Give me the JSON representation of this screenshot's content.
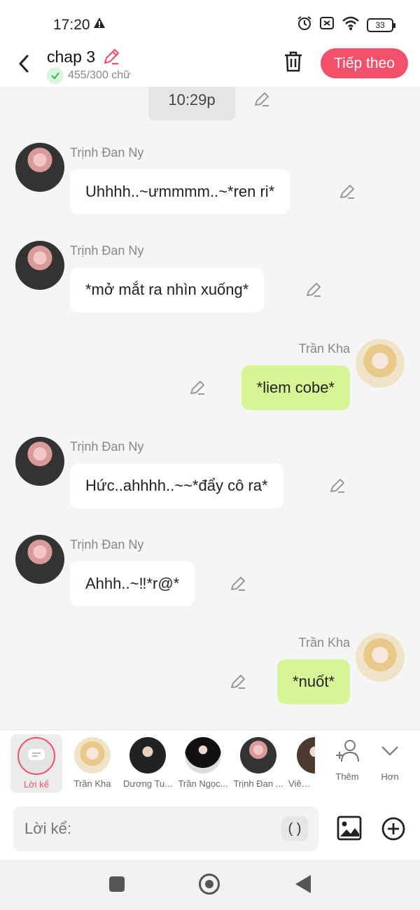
{
  "status": {
    "time": "17:20",
    "battery": "33"
  },
  "header": {
    "title": "chap 3",
    "word_count": "455/300 chữ",
    "next_label": "Tiếp theo"
  },
  "chat": {
    "time_label": "10:29p",
    "messages": [
      {
        "side": "left",
        "speaker": "Trịnh Đan Ny",
        "text": "Uhhhh..~ưmmmm..~*ren ri*"
      },
      {
        "side": "left",
        "speaker": "Trịnh Đan Ny",
        "text": "*mở mắt ra nhìn xuống*"
      },
      {
        "side": "right",
        "speaker": "Trần Kha",
        "text": "*liem cobe*"
      },
      {
        "side": "left",
        "speaker": "Trịnh Đan Ny",
        "text": "Hức..ahhhh..~~*đẩy cô ra*"
      },
      {
        "side": "left",
        "speaker": "Trịnh Đan Ny",
        "text": "Ahhh..~‼*r@*"
      },
      {
        "side": "right",
        "speaker": "Trần Kha",
        "text": "*nuốt*"
      }
    ]
  },
  "characters": {
    "narrator_label": "Lời kể",
    "items": [
      {
        "name": "Trần Kha"
      },
      {
        "name": "Dương Tu..."
      },
      {
        "name": "Trần Ngọc..."
      },
      {
        "name": "Trịnh Đan ..."
      },
      {
        "name": "Viên N"
      }
    ],
    "more_label": "Thêm",
    "less_label": "Hơn"
  },
  "input": {
    "placeholder": "Lời kể:",
    "paren_label": "( )"
  },
  "colors": {
    "accent": "#f2506b",
    "right_bubble": "#d8f595",
    "left_bubble": "#ffffff"
  }
}
